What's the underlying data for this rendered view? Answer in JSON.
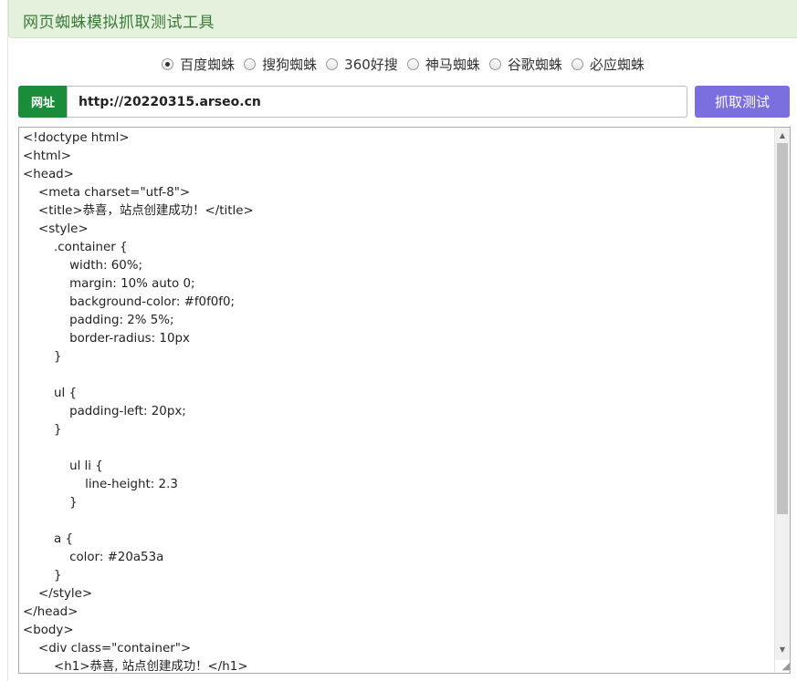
{
  "header": {
    "title": "网页蜘蛛模拟抓取测试工具"
  },
  "spiders": {
    "selected_index": 0,
    "options": [
      "百度蜘蛛",
      "搜狗蜘蛛",
      "360好搜",
      "神马蜘蛛",
      "谷歌蜘蛛",
      "必应蜘蛛"
    ]
  },
  "url_bar": {
    "label": "网址",
    "value": "http://20220315.arseo.cn",
    "button_label": "抓取测试"
  },
  "result": {
    "content": "<!doctype html>\n<html>\n<head>\n    <meta charset=\"utf-8\">\n    <title>恭喜，站点创建成功！</title>\n    <style>\n        .container {\n            width: 60%;\n            margin: 10% auto 0;\n            background-color: #f0f0f0;\n            padding: 2% 5%;\n            border-radius: 10px\n        }\n\n        ul {\n            padding-left: 20px;\n        }\n\n            ul li {\n                line-height: 2.3\n            }\n\n        a {\n            color: #20a53a\n        }\n    </style>\n</head>\n<body>\n    <div class=\"container\">\n        <h1>恭喜, 站点创建成功！</h1>"
  },
  "colors": {
    "header_bg": "#e3f1dd",
    "header_text": "#3d7a3a",
    "label_bg": "#1a8c3a",
    "button_bg": "#7b6fe0"
  },
  "icons": {
    "scroll_up": "▲",
    "scroll_down": "▼",
    "resize": "◢"
  }
}
